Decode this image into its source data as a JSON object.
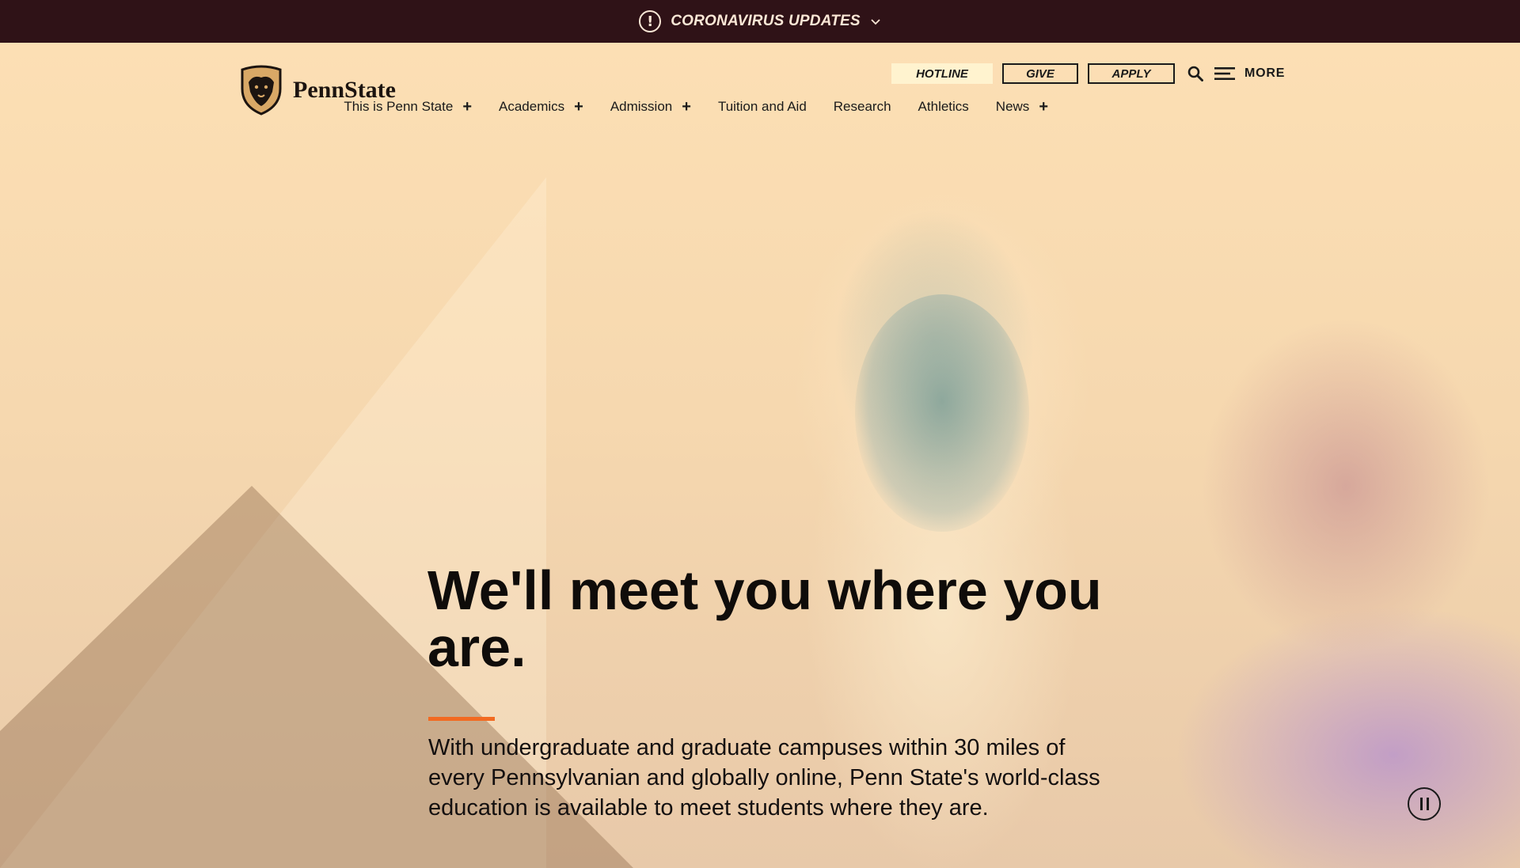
{
  "alert": {
    "label": "CORONAVIRUS UPDATES",
    "icon": "exclamation-circle-icon"
  },
  "brand": {
    "name": "PennState",
    "logo_icon": "nittany-lion-shield-icon"
  },
  "utility": {
    "hotline": "HOTLINE",
    "give": "GIVE",
    "apply": "APPLY",
    "search_icon": "search-icon",
    "menu_icon": "hamburger-menu-icon",
    "more": "MORE"
  },
  "nav": {
    "items": [
      {
        "label": "This is Penn State",
        "expandable": true
      },
      {
        "label": "Academics",
        "expandable": true
      },
      {
        "label": "Admission",
        "expandable": true
      },
      {
        "label": "Tuition and Aid",
        "expandable": false
      },
      {
        "label": "Research",
        "expandable": false
      },
      {
        "label": "Athletics",
        "expandable": false
      },
      {
        "label": "News",
        "expandable": true
      }
    ],
    "expand_symbol": "+"
  },
  "hero": {
    "headline": "We'll meet you where you are.",
    "body": "With undergraduate and graduate campuses within 30 miles of every Pennsylvanian and globally online, Penn State's world-class education is available to meet students where they are.",
    "pause_icon": "pause-icon"
  },
  "colors": {
    "alert_bg": "#2f1217",
    "accent": "#f26a21",
    "hotline_bg": "#fff3cf",
    "text": "#1a1a1a"
  }
}
